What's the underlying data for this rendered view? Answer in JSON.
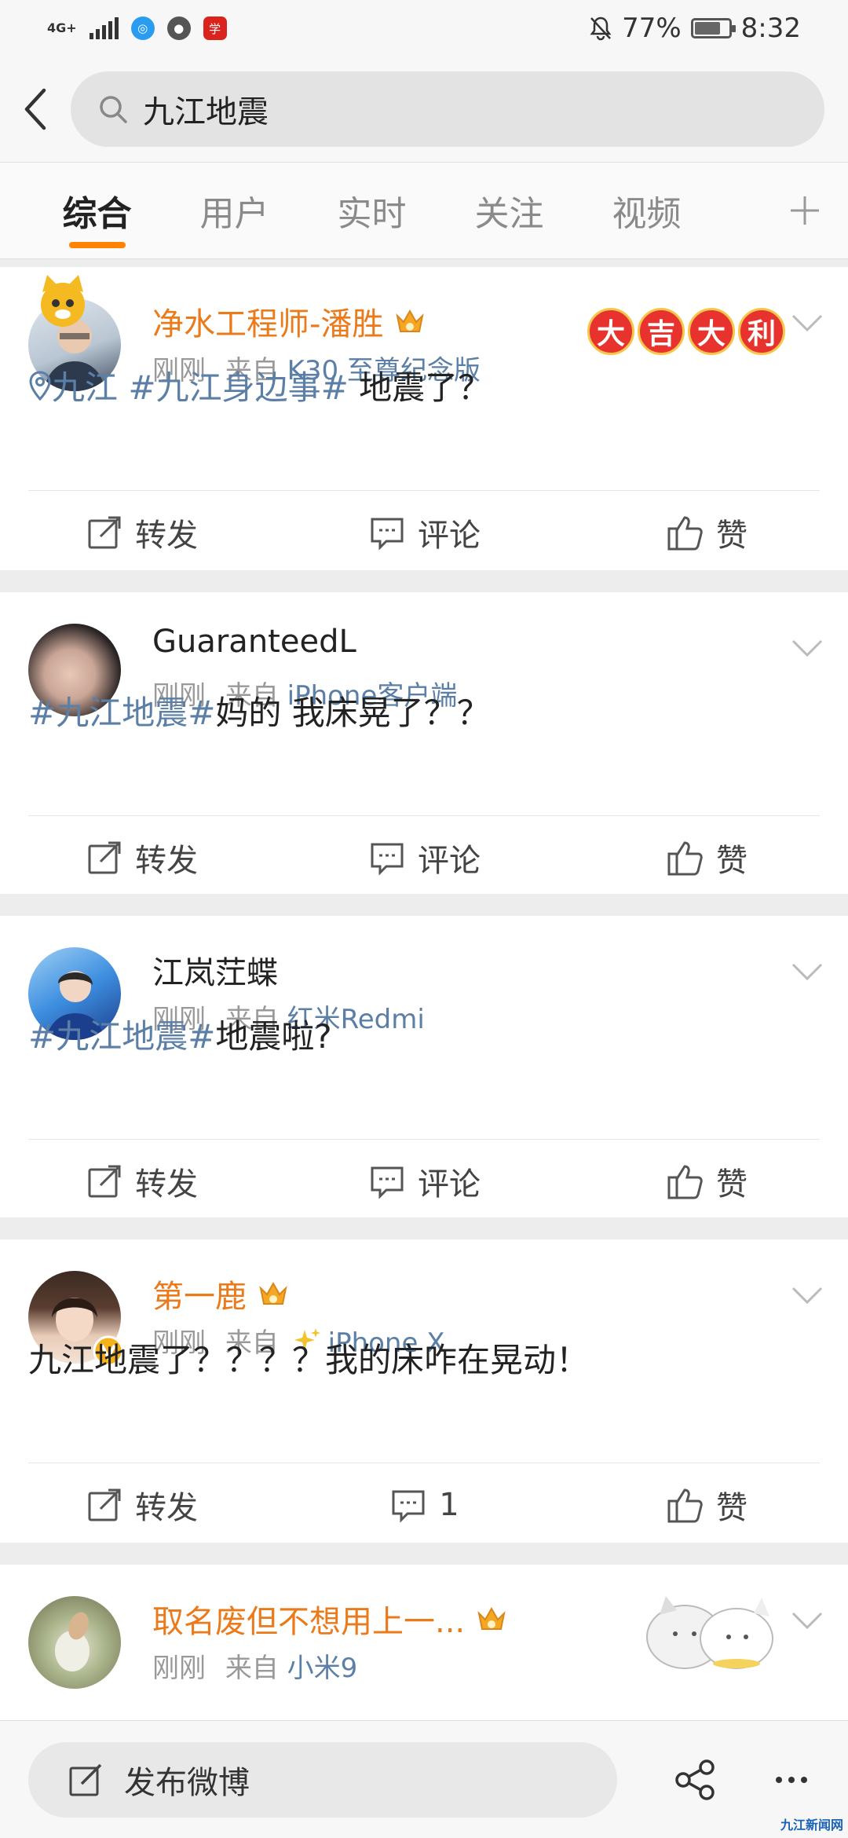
{
  "status_bar": {
    "network": "4G+",
    "battery": "77%",
    "time": "8:32",
    "icons": [
      "signal-icon",
      "qq-browser-icon",
      "wechat-icon",
      "xuexi-icon",
      "mute-icon",
      "battery-icon"
    ]
  },
  "search": {
    "query": "九江地震"
  },
  "tabs": [
    {
      "label": "综合",
      "active": true
    },
    {
      "label": "用户",
      "active": false
    },
    {
      "label": "实时",
      "active": false
    },
    {
      "label": "关注",
      "active": false
    },
    {
      "label": "视频",
      "active": false
    }
  ],
  "posts": [
    {
      "username": "净水工程师-潘胜",
      "vip": true,
      "time": "刚刚",
      "from_label": "来自",
      "source": "K30 至尊纪念版",
      "location": "九江",
      "topic": "#九江身边事#",
      "text": " 地震了？",
      "badge": [
        "大",
        "吉",
        "大",
        "利"
      ],
      "actions": {
        "repost": "转发",
        "comment": "评论",
        "like": "赞"
      }
    },
    {
      "username": "GuaranteedL",
      "vip": false,
      "time": "刚刚",
      "from_label": "来自",
      "source": "iPhone客户端",
      "topic": "#九江地震#",
      "text": "妈的 我床晃了？？",
      "actions": {
        "repost": "转发",
        "comment": "评论",
        "like": "赞"
      }
    },
    {
      "username": "江岚茳蝶",
      "vip": false,
      "time": "刚刚",
      "from_label": "来自",
      "source": "红米Redmi",
      "topic": "#九江地震#",
      "text": "地震啦?",
      "actions": {
        "repost": "转发",
        "comment": "评论",
        "like": "赞"
      }
    },
    {
      "username": "第一鹿",
      "vip": true,
      "verified": true,
      "time": "刚刚",
      "from_label": "来自",
      "source": "iPhone X",
      "text": "九江地震了？？？？我的床咋在晃动！",
      "actions": {
        "repost": "转发",
        "comment": "1",
        "like": "赞"
      }
    },
    {
      "username": "取名废但不想用上一...",
      "vip": true,
      "time": "刚刚",
      "from_label": "来自",
      "source": "小米9"
    }
  ],
  "bottom_bar": {
    "compose_label": "发布微博"
  },
  "watermark": "九江新闻网",
  "colors": {
    "accent": "#ff8200",
    "vip_name": "#eb7a1b",
    "link": "#5b7fa6",
    "meta": "#999999"
  }
}
